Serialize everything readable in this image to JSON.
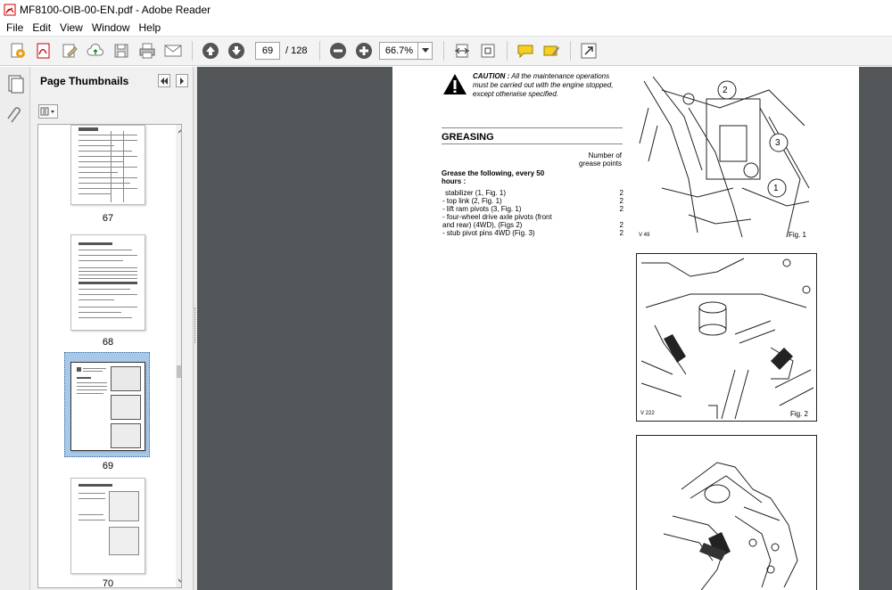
{
  "window": {
    "title": "MF8100-OIB-00-EN.pdf - Adobe Reader"
  },
  "menu": [
    "File",
    "Edit",
    "View",
    "Window",
    "Help"
  ],
  "toolbar": {
    "page_current": "69",
    "page_total": "/ 128",
    "zoom": "66.7%"
  },
  "thumbnails": {
    "title": "Page Thumbnails",
    "pages": [
      {
        "label": "67"
      },
      {
        "label": "68"
      },
      {
        "label": "69",
        "selected": true
      },
      {
        "label": "70"
      }
    ]
  },
  "document": {
    "caution_bold": "CAUTION :",
    "caution_text": "All the maintenance operations must be carried out with the engine stopped, except otherwise specified.",
    "section_title": "GREASING",
    "column_header": "Number of grease points",
    "intro": "Grease the following, every 50 hours :",
    "items": [
      {
        "text": "stabilizer (1, Fig. 1)",
        "value": "2"
      },
      {
        "text": "- top link (2, Fig. 1)",
        "value": "2"
      },
      {
        "text": "- lift ram pivots (3, Fig. 1)",
        "value": "2"
      },
      {
        "text": "- four-wheel drive axle pivots (front",
        "value": ""
      },
      {
        "text": "and rear) (4WD), (Figs 2)",
        "value": "2"
      },
      {
        "text": "- stub pivot pins 4WD (Fig. 3)",
        "value": "2"
      }
    ],
    "figures": [
      {
        "label": "Fig. 1",
        "code": "V 49",
        "callouts": [
          "2",
          "3",
          "1"
        ]
      },
      {
        "label": "Fig. 2",
        "code": "V 222"
      },
      {
        "label": "",
        "code": ""
      }
    ]
  },
  "colors": {
    "doc_background": "#525659",
    "toolbar_bg": "#f3f3f3",
    "selection": "#a8c8e8"
  }
}
